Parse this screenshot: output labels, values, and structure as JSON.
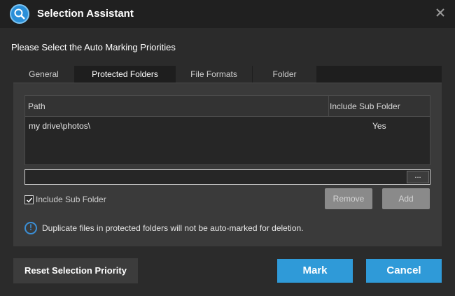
{
  "window": {
    "title": "Selection Assistant"
  },
  "subtitle": "Please Select the Auto Marking Priorities",
  "tabs": [
    {
      "label": "General",
      "active": false
    },
    {
      "label": "Protected Folders",
      "active": true
    },
    {
      "label": "File Formats",
      "active": false
    },
    {
      "label": "Folder",
      "active": false
    }
  ],
  "table": {
    "columns": [
      "Path",
      "Include Sub Folder"
    ],
    "rows": [
      {
        "path": "my drive\\photos\\",
        "include_sub_folder": "Yes"
      }
    ]
  },
  "path_input": {
    "value": "",
    "browse_label": "..."
  },
  "include_sub_folder": {
    "label": "Include Sub Folder",
    "checked": true
  },
  "buttons": {
    "remove": "Remove",
    "add": "Add",
    "reset": "Reset Selection Priority",
    "mark": "Mark",
    "cancel": "Cancel"
  },
  "info": {
    "text": "Duplicate files in protected folders will not be auto-marked for deletion.",
    "icon": "info-icon"
  },
  "colors": {
    "accent": "#2f9ad8",
    "background": "#2b2b2b",
    "titlebar": "#202020"
  }
}
